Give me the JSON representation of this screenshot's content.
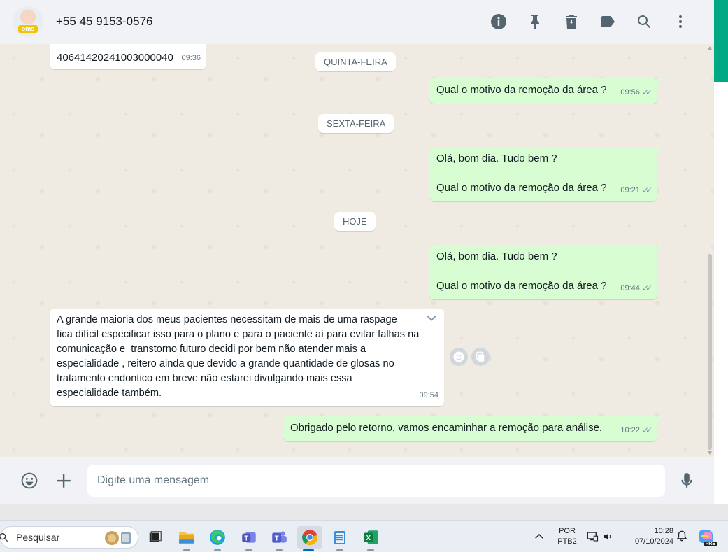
{
  "header": {
    "contact_name": "+55 45 9153-0576",
    "avatar_badge": "oms"
  },
  "messages": [
    {
      "id": "m0",
      "dir": "in",
      "text": "40641420241003000040",
      "time": "09:36"
    },
    {
      "id": "d1",
      "type": "date",
      "text": "QUINTA-FEIRA"
    },
    {
      "id": "m1",
      "dir": "out",
      "text": "Qual o motivo da remoção da área ?",
      "time": "09:56",
      "ticks": "✓✓"
    },
    {
      "id": "d2",
      "type": "date",
      "text": "SEXTA-FEIRA"
    },
    {
      "id": "m2",
      "dir": "out",
      "text": "Olá, bom dia. Tudo bem ?\n\nQual o motivo da remoção da área ?",
      "time": "09:21",
      "ticks": "✓✓"
    },
    {
      "id": "d3",
      "type": "date",
      "text": "HOJE"
    },
    {
      "id": "m3",
      "dir": "out",
      "text": "Olá, bom dia. Tudo bem ?\n\nQual o motivo da remoção da área ?",
      "time": "09:44",
      "ticks": "✓✓"
    },
    {
      "id": "m4",
      "dir": "in",
      "text": "A grande maioria dos meus pacientes necessitam de mais de uma raspage\nfica difícil especificar isso para o plano e para o paciente aí para evitar falhas na\ncomunicação e  transtorno futuro decidi por bem não atender mais a\nespecialidade , reitero ainda que devido a grande quantidade de glosas no\ntratamento endontico em breve não estarei divulgando mais essa\nespecialidade também.",
      "time": "09:54"
    },
    {
      "id": "m5",
      "dir": "out",
      "text": "Obrigado pelo retorno, vamos encaminhar a remoção para análise.",
      "time": "10:22",
      "ticks": "✓✓"
    }
  ],
  "compose": {
    "placeholder": "Digite uma mensagem"
  },
  "taskbar": {
    "search_label": "Pesquisar",
    "lang_top": "POR",
    "lang_bottom": "PTB2",
    "time": "10:28",
    "date": "07/10/2024",
    "copilot_badge": "PRE"
  },
  "colors": {
    "outgoing_bubble": "#d9fdd3",
    "incoming_bubble": "#ffffff",
    "chat_bg": "#efeae2",
    "accent": "#00a884"
  }
}
